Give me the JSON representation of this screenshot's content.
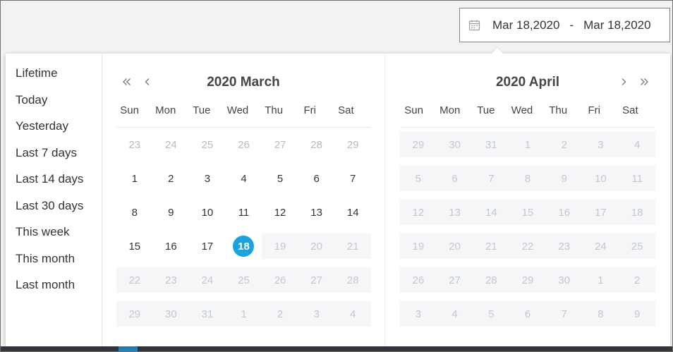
{
  "date_range": {
    "icon": "calendar-icon",
    "start": "Mar 18,2020",
    "separator": "-",
    "end": "Mar 18,2020"
  },
  "shortcuts": [
    {
      "label": "Lifetime"
    },
    {
      "label": "Today"
    },
    {
      "label": "Yesterday"
    },
    {
      "label": "Last 7 days"
    },
    {
      "label": "Last 14 days"
    },
    {
      "label": "Last 30 days"
    },
    {
      "label": "This week"
    },
    {
      "label": "This month"
    },
    {
      "label": "Last month"
    }
  ],
  "calendars": [
    {
      "title": "2020 March",
      "nav_icons": [
        "double-chevron-left-icon",
        "chevron-left-icon"
      ],
      "weekdays": [
        "Sun",
        "Mon",
        "Tue",
        "Wed",
        "Thu",
        "Fri",
        "Sat"
      ],
      "weeks": [
        [
          {
            "day": 23,
            "state": "prev-month"
          },
          {
            "day": 24,
            "state": "prev-month"
          },
          {
            "day": 25,
            "state": "prev-month"
          },
          {
            "day": 26,
            "state": "prev-month"
          },
          {
            "day": 27,
            "state": "prev-month"
          },
          {
            "day": 28,
            "state": "prev-month"
          },
          {
            "day": 29,
            "state": "prev-month"
          }
        ],
        [
          {
            "day": 1,
            "state": "current"
          },
          {
            "day": 2,
            "state": "current"
          },
          {
            "day": 3,
            "state": "current"
          },
          {
            "day": 4,
            "state": "current"
          },
          {
            "day": 5,
            "state": "current"
          },
          {
            "day": 6,
            "state": "current"
          },
          {
            "day": 7,
            "state": "current"
          }
        ],
        [
          {
            "day": 8,
            "state": "current"
          },
          {
            "day": 9,
            "state": "current"
          },
          {
            "day": 10,
            "state": "current"
          },
          {
            "day": 11,
            "state": "current"
          },
          {
            "day": 12,
            "state": "current"
          },
          {
            "day": 13,
            "state": "current"
          },
          {
            "day": 14,
            "state": "current"
          }
        ],
        [
          {
            "day": 15,
            "state": "current"
          },
          {
            "day": 16,
            "state": "current"
          },
          {
            "day": 17,
            "state": "current"
          },
          {
            "day": 18,
            "state": "selected"
          },
          {
            "day": 19,
            "state": "disabled"
          },
          {
            "day": 20,
            "state": "disabled"
          },
          {
            "day": 21,
            "state": "disabled"
          }
        ],
        [
          {
            "day": 22,
            "state": "disabled"
          },
          {
            "day": 23,
            "state": "disabled"
          },
          {
            "day": 24,
            "state": "disabled"
          },
          {
            "day": 25,
            "state": "disabled"
          },
          {
            "day": 26,
            "state": "disabled"
          },
          {
            "day": 27,
            "state": "disabled"
          },
          {
            "day": 28,
            "state": "disabled"
          }
        ],
        [
          {
            "day": 29,
            "state": "disabled"
          },
          {
            "day": 30,
            "state": "disabled"
          },
          {
            "day": 31,
            "state": "disabled"
          },
          {
            "day": 1,
            "state": "disabled"
          },
          {
            "day": 2,
            "state": "disabled"
          },
          {
            "day": 3,
            "state": "disabled"
          },
          {
            "day": 4,
            "state": "disabled"
          }
        ]
      ]
    },
    {
      "title": "2020 April",
      "nav_icons": [
        "chevron-right-icon",
        "double-chevron-right-icon"
      ],
      "weekdays": [
        "Sun",
        "Mon",
        "Tue",
        "Wed",
        "Thu",
        "Fri",
        "Sat"
      ],
      "weeks": [
        [
          {
            "day": 29,
            "state": "disabled"
          },
          {
            "day": 30,
            "state": "disabled"
          },
          {
            "day": 31,
            "state": "disabled"
          },
          {
            "day": 1,
            "state": "disabled"
          },
          {
            "day": 2,
            "state": "disabled"
          },
          {
            "day": 3,
            "state": "disabled"
          },
          {
            "day": 4,
            "state": "disabled"
          }
        ],
        [
          {
            "day": 5,
            "state": "disabled"
          },
          {
            "day": 6,
            "state": "disabled"
          },
          {
            "day": 7,
            "state": "disabled"
          },
          {
            "day": 8,
            "state": "disabled"
          },
          {
            "day": 9,
            "state": "disabled"
          },
          {
            "day": 10,
            "state": "disabled"
          },
          {
            "day": 11,
            "state": "disabled"
          }
        ],
        [
          {
            "day": 12,
            "state": "disabled"
          },
          {
            "day": 13,
            "state": "disabled"
          },
          {
            "day": 14,
            "state": "disabled"
          },
          {
            "day": 15,
            "state": "disabled"
          },
          {
            "day": 16,
            "state": "disabled"
          },
          {
            "day": 17,
            "state": "disabled"
          },
          {
            "day": 18,
            "state": "disabled"
          }
        ],
        [
          {
            "day": 19,
            "state": "disabled"
          },
          {
            "day": 20,
            "state": "disabled"
          },
          {
            "day": 21,
            "state": "disabled"
          },
          {
            "day": 22,
            "state": "disabled"
          },
          {
            "day": 23,
            "state": "disabled"
          },
          {
            "day": 24,
            "state": "disabled"
          },
          {
            "day": 25,
            "state": "disabled"
          }
        ],
        [
          {
            "day": 26,
            "state": "disabled"
          },
          {
            "day": 27,
            "state": "disabled"
          },
          {
            "day": 28,
            "state": "disabled"
          },
          {
            "day": 29,
            "state": "disabled"
          },
          {
            "day": 30,
            "state": "disabled"
          },
          {
            "day": 1,
            "state": "disabled"
          },
          {
            "day": 2,
            "state": "disabled"
          }
        ],
        [
          {
            "day": 3,
            "state": "disabled"
          },
          {
            "day": 4,
            "state": "disabled"
          },
          {
            "day": 5,
            "state": "disabled"
          },
          {
            "day": 6,
            "state": "disabled"
          },
          {
            "day": 7,
            "state": "disabled"
          },
          {
            "day": 8,
            "state": "disabled"
          },
          {
            "day": 9,
            "state": "disabled"
          }
        ]
      ]
    }
  ],
  "colors": {
    "accent": "#1aa3df",
    "disabled_bg": "#f5f6f8",
    "bottom_bar": "#323840",
    "bottom_tab": "#1d87c7"
  }
}
